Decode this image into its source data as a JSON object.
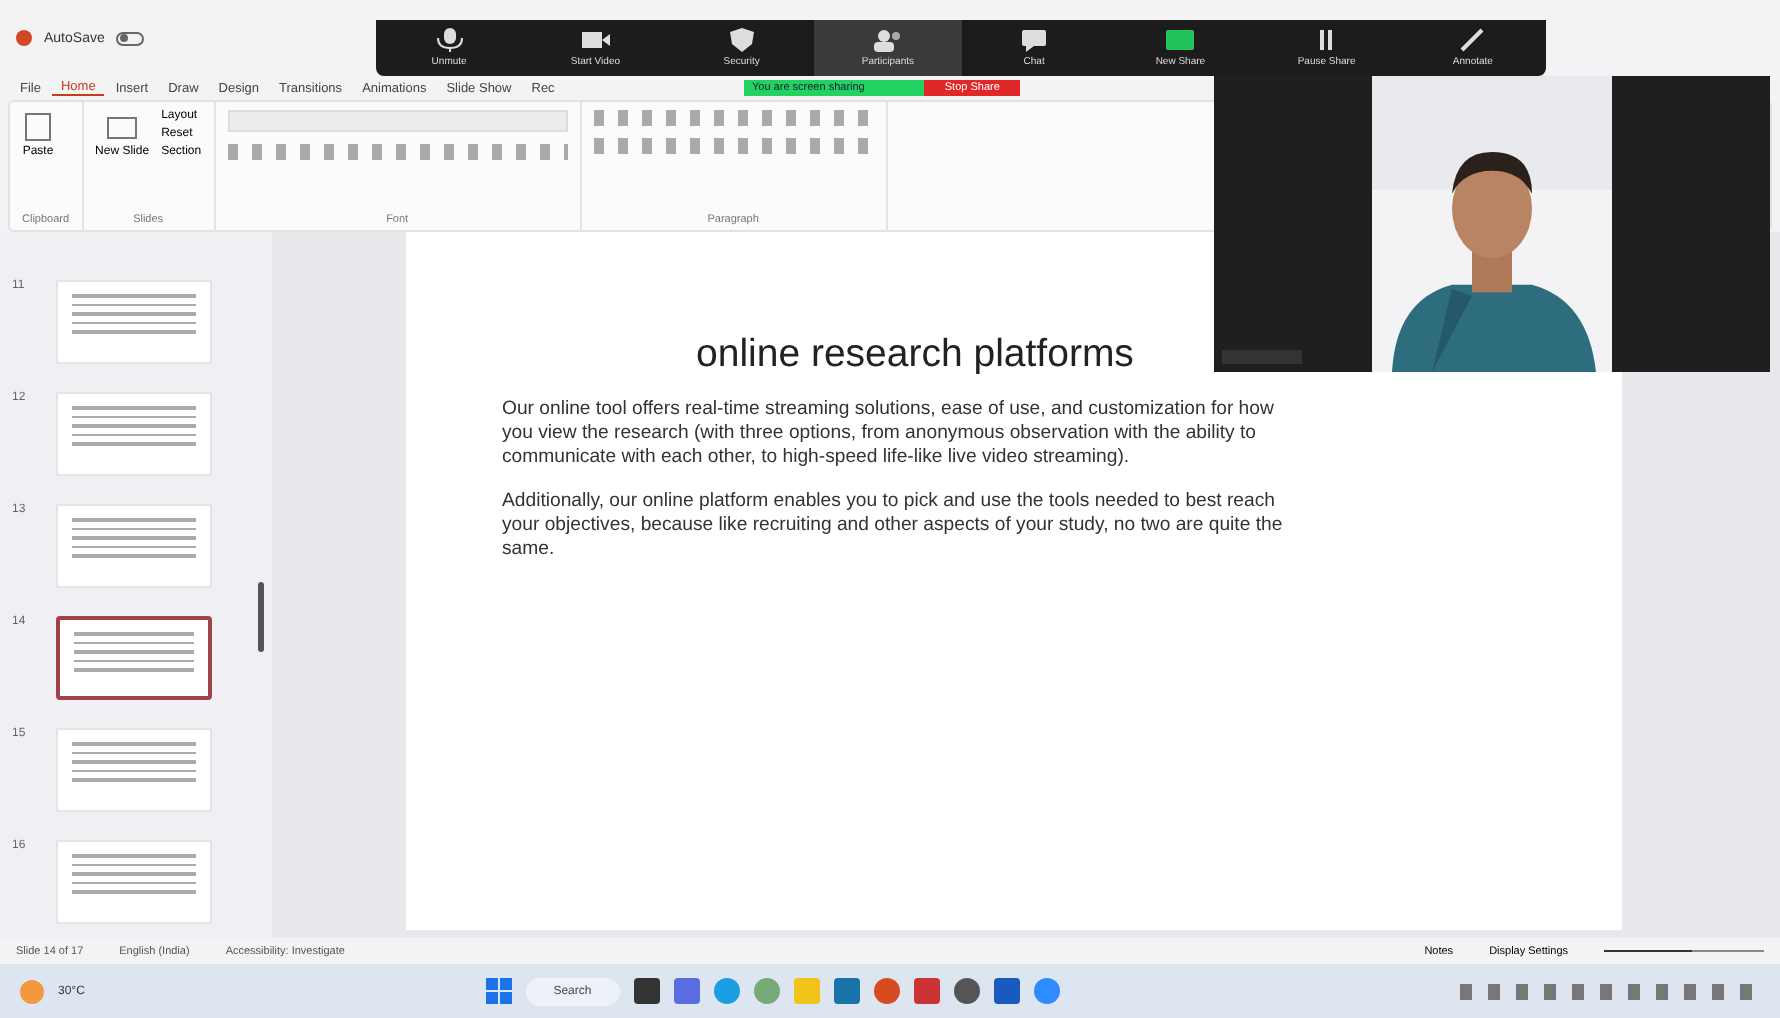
{
  "title_bar": {
    "autosave": "AutoSave",
    "autosave_on": false
  },
  "zoom_toolbar": {
    "buttons": [
      {
        "kind": "mic",
        "label": "Unmute",
        "selected": false
      },
      {
        "kind": "video",
        "label": "Start Video",
        "selected": false
      },
      {
        "kind": "shield",
        "label": "Security",
        "selected": false
      },
      {
        "kind": "people",
        "label": "Participants",
        "selected": true
      },
      {
        "kind": "chat",
        "label": "Chat",
        "selected": false
      },
      {
        "kind": "share",
        "label": "New Share",
        "selected": false
      },
      {
        "kind": "pause",
        "label": "Pause Share",
        "selected": false
      },
      {
        "kind": "pen",
        "label": "Annotate",
        "selected": false
      }
    ]
  },
  "share_banner": {
    "status": "You are screen sharing",
    "stop": "Stop Share"
  },
  "ribbon": {
    "tabs": [
      {
        "label": "File",
        "selected": false
      },
      {
        "label": "Home",
        "selected": true
      },
      {
        "label": "Insert",
        "selected": false
      },
      {
        "label": "Draw",
        "selected": false
      },
      {
        "label": "Design",
        "selected": false
      },
      {
        "label": "Transitions",
        "selected": false
      },
      {
        "label": "Animations",
        "selected": false
      },
      {
        "label": "Slide Show",
        "selected": false
      },
      {
        "label": "Rec",
        "selected": false
      }
    ],
    "paste": "Paste",
    "new_slide": "New Slide",
    "slide_options": [
      "Layout",
      "Reset",
      "Section"
    ],
    "group_labels": [
      "Clipboard",
      "Slides",
      "Font",
      "Paragraph"
    ]
  },
  "thumbnails": [
    {
      "number": "11",
      "selected": false
    },
    {
      "number": "12",
      "selected": false
    },
    {
      "number": "13",
      "selected": false
    },
    {
      "number": "14",
      "selected": true
    },
    {
      "number": "15",
      "selected": false
    },
    {
      "number": "16",
      "selected": false
    }
  ],
  "slide": {
    "title": "online research platforms",
    "paragraphs": [
      "Our online tool offers real-time streaming solutions, ease of use, and customization for how you view the research (with three options, from anonymous observation with the ability to communicate with each other, to high-speed life-like live video streaming).",
      "Additionally, our online platform enables you to pick and use the tools needed to best reach your objectives, because like recruiting and other aspects of your study, no two are quite the same."
    ]
  },
  "status_bar": {
    "slide_count": "Slide 14 of 17",
    "language": "English (India)",
    "accessibility": "Accessibility: Investigate",
    "notes": "Notes",
    "display": "Display Settings",
    "zoom": {
      "level": 0.55
    }
  },
  "taskbar": {
    "weather": "30°C",
    "search": "Search"
  }
}
